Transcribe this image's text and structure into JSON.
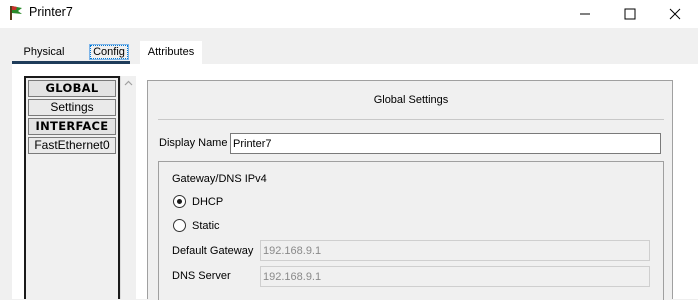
{
  "window": {
    "title": "Printer7",
    "icon": "printer-flag-icon"
  },
  "tabs": [
    {
      "label": "Physical"
    },
    {
      "label": "Config",
      "active": true
    },
    {
      "label": "Attributes"
    }
  ],
  "sidebar": {
    "items": [
      {
        "label": "GLOBAL",
        "kind": "header"
      },
      {
        "label": "Settings",
        "kind": "item"
      },
      {
        "label": "INTERFACE",
        "kind": "header"
      },
      {
        "label": "FastEthernet0",
        "kind": "item"
      }
    ]
  },
  "global_settings": {
    "title": "Global Settings",
    "display_name_label": "Display Name",
    "display_name_value": "Printer7",
    "ipv4_group_label": "Gateway/DNS IPv4",
    "mode_options": [
      {
        "label": "DHCP",
        "selected": true
      },
      {
        "label": "Static",
        "selected": false
      }
    ],
    "default_gateway_label": "Default Gateway",
    "default_gateway_value": "192.168.9.1",
    "dns_server_label": "DNS Server",
    "dns_server_value": "192.168.9.1"
  }
}
